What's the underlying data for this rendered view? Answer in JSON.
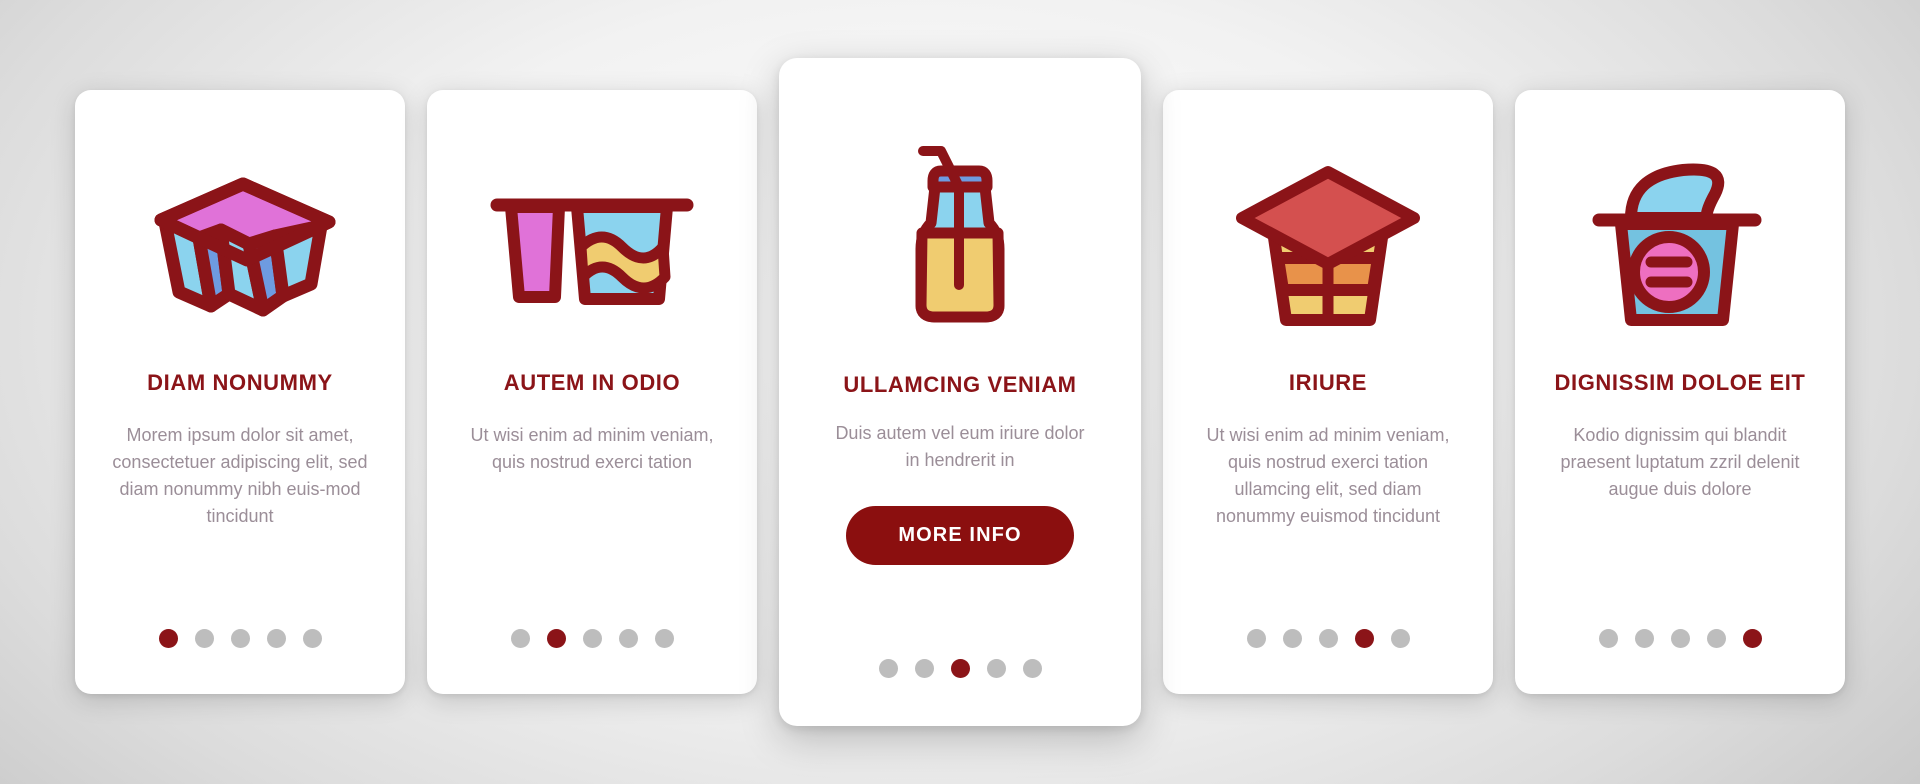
{
  "theme": {
    "background_gradient_from": "#ffffff",
    "background_gradient_to": "#b9b9b9",
    "card_bg": "#ffffff",
    "accent_dark_red": "#8B1418",
    "button_red": "#8B0F0F",
    "body_text_gray": "#9B8E98",
    "dot_inactive": "#BDBDBD",
    "icon_stroke": "#8B1418",
    "icon_magenta": "#E072D8",
    "icon_light_blue": "#8BD3EE",
    "icon_blue": "#6E9BE0",
    "icon_yellow": "#F0CC70",
    "icon_orange": "#E8924A",
    "icon_lid_red": "#D4504F",
    "icon_pink": "#EE6FC0"
  },
  "cards": [
    {
      "icon_name": "yogurt-multipack-tray-icon",
      "title": "DIAM NONUMMY",
      "description": "Morem ipsum dolor sit amet, consectetuer adipiscing elit, sed diam nonummy nibh euis-mod tincidunt",
      "dots_total": 5,
      "dot_active_index": 0,
      "featured": false,
      "cta_label": null
    },
    {
      "icon_name": "twin-yogurt-cups-icon",
      "title": "AUTEM IN ODIO",
      "description": "Ut wisi enim ad minim veniam, quis nostrud exerci tation",
      "dots_total": 5,
      "dot_active_index": 1,
      "featured": false,
      "cta_label": null
    },
    {
      "icon_name": "milk-bottle-with-straw-icon",
      "title": "ULLAMCING VENIAM",
      "description": "Duis autem vel eum iriure dolor in hendrerit in",
      "dots_total": 5,
      "dot_active_index": 2,
      "featured": true,
      "cta_label": "MORE INFO"
    },
    {
      "icon_name": "layered-yogurt-pot-icon",
      "title": "IRIURE",
      "description": "Ut wisi enim ad minim veniam, quis nostrud exerci tation ullamcing elit, sed diam nonummy euismod tincidunt",
      "dots_total": 5,
      "dot_active_index": 3,
      "featured": false,
      "cta_label": null
    },
    {
      "icon_name": "soft-serve-yogurt-cup-icon",
      "title": "DIGNISSIM DOLOE EIT",
      "description": "Kodio dignissim qui blandit praesent luptatum zzril delenit augue duis dolore",
      "dots_total": 5,
      "dot_active_index": 4,
      "featured": false,
      "cta_label": null
    }
  ]
}
